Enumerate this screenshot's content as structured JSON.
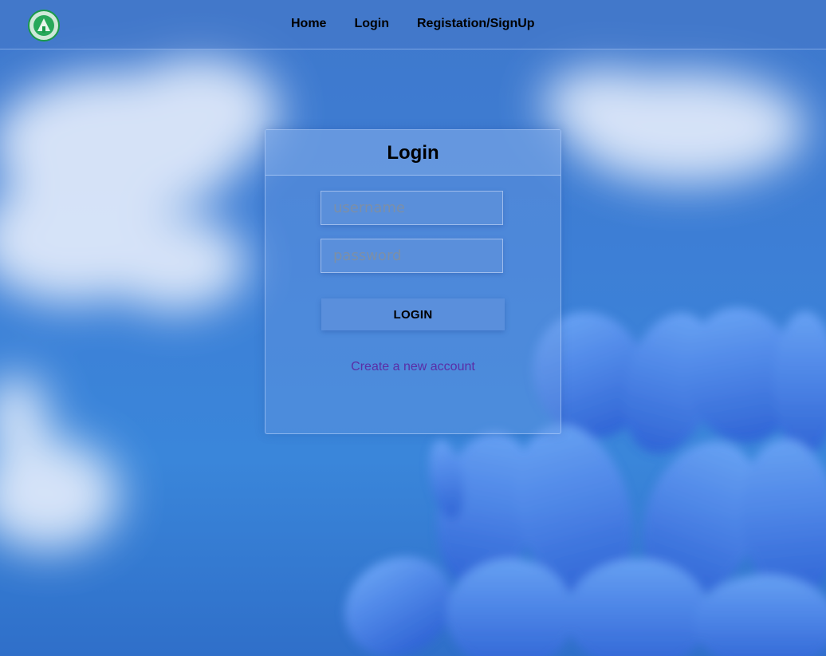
{
  "nav": {
    "items": [
      "Home",
      "Login",
      "Registation/SignUp"
    ]
  },
  "login": {
    "title": "Login",
    "username_placeholder": "username",
    "password_placeholder": "password",
    "button_label": "LOGIN",
    "create_account_link": "Create a new account"
  },
  "colors": {
    "link": "#5a2ea6",
    "logo": "#1a9a4a"
  }
}
